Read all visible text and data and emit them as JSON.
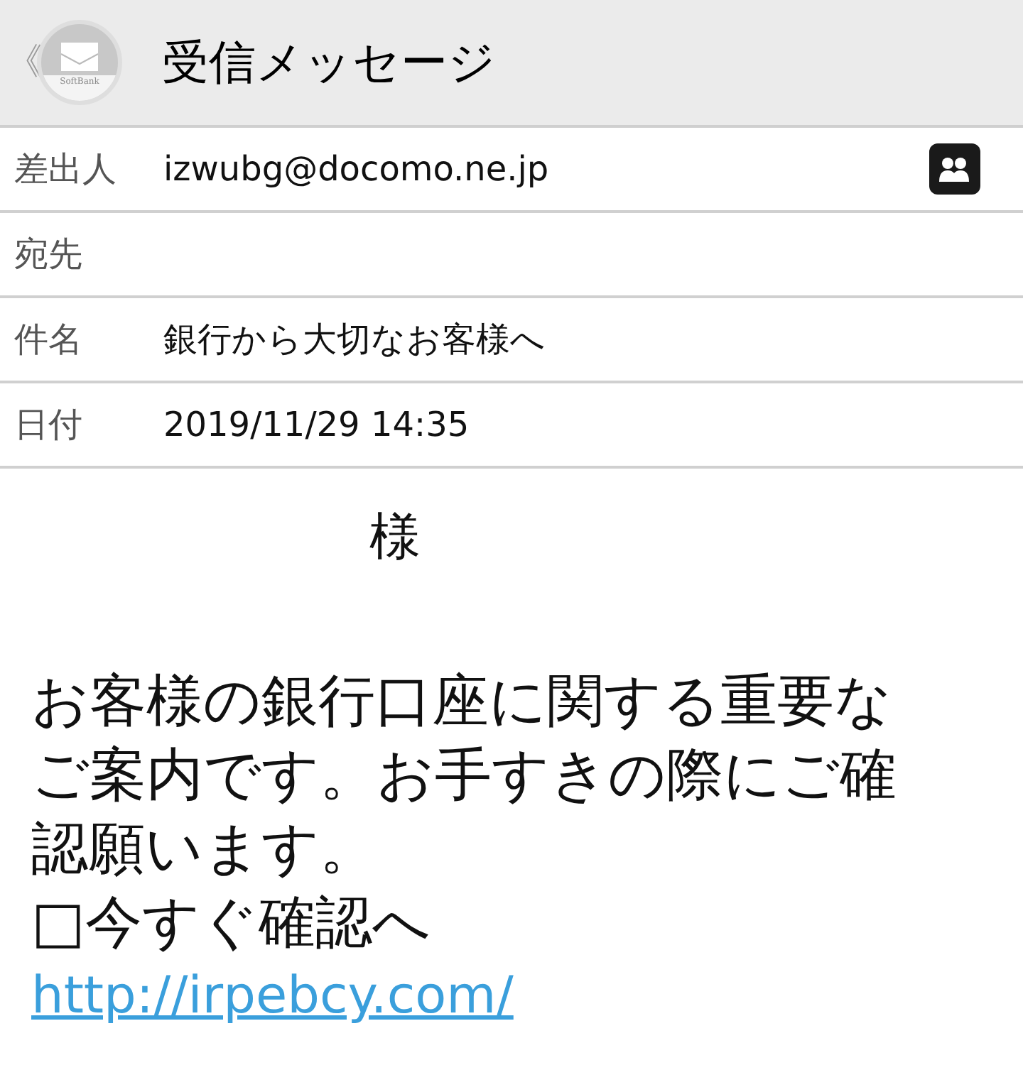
{
  "header": {
    "back": "《",
    "title": "受信メッセージ",
    "logo_text": "SoftBank"
  },
  "fields": [
    {
      "label": "差出人",
      "value": "izwubg@docomo.ne.jp",
      "contact_button": true
    },
    {
      "label": "宛先",
      "contact_button": false
    },
    {
      "label": "件名",
      "value": "銀行から大切なお客様へ",
      "contact_button": false
    },
    {
      "label": "日付",
      "value": "2019/11/29 14:35",
      "contact_button": false
    }
  ],
  "body": {
    "salutation": "様",
    "lines": [
      "お客様の銀行口座に関する重要な",
      "ご案内です。お手すきの際にご確",
      "認願います。",
      "□今すぐ確認へ"
    ],
    "link": "http://irpebcy.com/"
  }
}
